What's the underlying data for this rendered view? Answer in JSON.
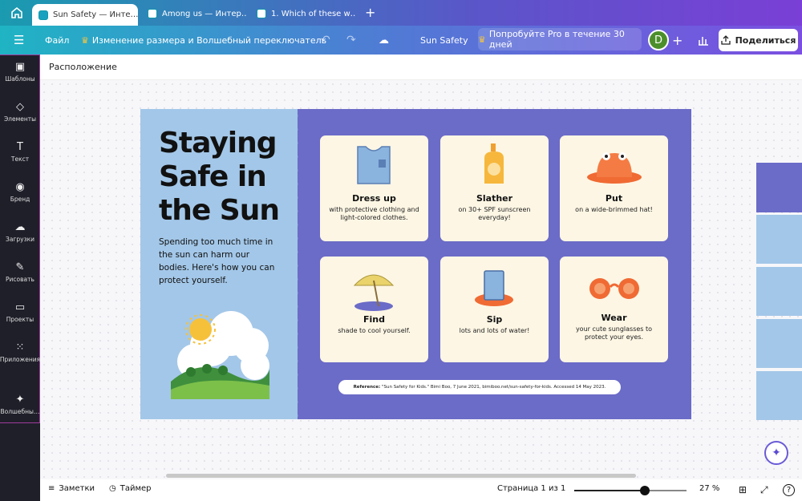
{
  "browser": {
    "tabs": [
      {
        "label": "Sun Safety — Инте…"
      },
      {
        "label": "Among us — Интер…"
      },
      {
        "label": "1. Which of these w…"
      }
    ]
  },
  "toolbar": {
    "file": "Файл",
    "resize": "Изменение размера и Волшебный переключатель",
    "doc_title": "Sun Safety",
    "pro": "Попробуйте Pro в течение 30 дней",
    "avatar": "D",
    "share": "Поделиться"
  },
  "sidebar": {
    "items": [
      {
        "label": "Шаблоны",
        "icon": "templates-icon"
      },
      {
        "label": "Элементы",
        "icon": "elements-icon"
      },
      {
        "label": "Текст",
        "icon": "text-icon"
      },
      {
        "label": "Бренд",
        "icon": "brand-icon"
      },
      {
        "label": "Загрузки",
        "icon": "upload-icon"
      },
      {
        "label": "Рисовать",
        "icon": "draw-icon"
      },
      {
        "label": "Проекты",
        "icon": "folder-icon"
      },
      {
        "label": "Приложения",
        "icon": "apps-icon"
      },
      {
        "label": "Волшебны…",
        "icon": "magic-media-icon"
      }
    ]
  },
  "panel_header": "Расположение",
  "slide": {
    "title_lines": [
      "Staying",
      "Safe in",
      "the Sun"
    ],
    "lead": "Spending too much time in the sun can harm our bodies. Here's how you can protect yourself.",
    "cards": [
      {
        "title": "Dress up",
        "text": "with protective clothing and light-colored clothes.",
        "icon": "tank-top-icon"
      },
      {
        "title": "Slather",
        "text": "on 30+ SPF sunscreen everyday!",
        "icon": "sunscreen-bottle-icon"
      },
      {
        "title": "Put",
        "text": "on a wide-brimmed hat!",
        "icon": "sun-hat-icon"
      },
      {
        "title": "Find",
        "text": "shade to cool yourself.",
        "icon": "beach-umbrella-icon"
      },
      {
        "title": "Sip",
        "text": "lots and lots of water!",
        "icon": "water-glass-icon"
      },
      {
        "title": "Wear",
        "text": "your cute sunglasses to protect your eyes.",
        "icon": "sunglasses-icon"
      }
    ],
    "reference_label": "Reference:",
    "reference": "\"Sun Safety for Kids.\" Bimi Boo, 7 June 2021, bimiboo.net/sun-safety-for-kids. Accessed 14 May 2023.",
    "colors": {
      "panel": "#a3c7e8",
      "background": "#6b6bc8",
      "card": "#fdf6e4"
    }
  },
  "bottom": {
    "notes": "Заметки",
    "timer": "Таймер",
    "page": "Страница 1 из 1",
    "zoom": "27 %",
    "zoom_value": 0.27,
    "help": "?"
  }
}
